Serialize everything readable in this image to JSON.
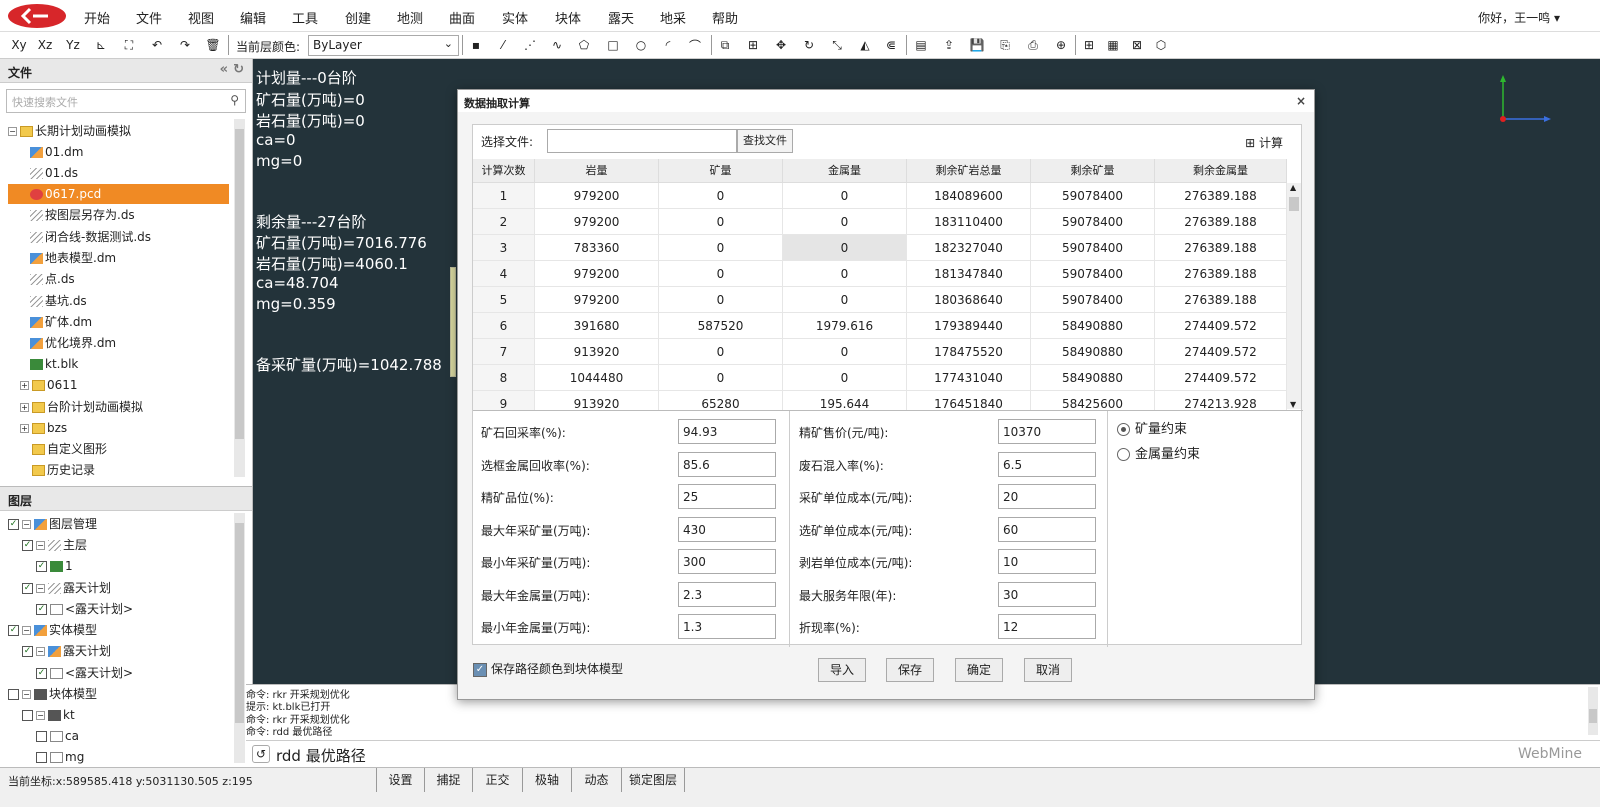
{
  "menu": [
    "开始",
    "文件",
    "视图",
    "编辑",
    "工具",
    "创建",
    "地测",
    "曲面",
    "实体",
    "块体",
    "露天",
    "地采",
    "帮助"
  ],
  "user": {
    "greeting": "你好，王一鸣 ▾"
  },
  "toolbar": {
    "coord_buttons": [
      "Xy",
      "Xz",
      "Yz"
    ],
    "layer_color_label": "当前层颜色:",
    "layer_color_value": "ByLayer"
  },
  "files_panel": {
    "title": "文件",
    "search_placeholder": "快速搜索文件",
    "items": [
      {
        "label": "长期计划动画模拟",
        "type": "folder"
      },
      {
        "label": "01.dm",
        "type": "dm"
      },
      {
        "label": "01.ds",
        "type": "ds"
      },
      {
        "label": "0617.pcd",
        "type": "pcd"
      },
      {
        "label": "按图层另存为.ds",
        "type": "ds"
      },
      {
        "label": "闭合线-数据测试.ds",
        "type": "ds"
      },
      {
        "label": "地表模型.dm",
        "type": "dm"
      },
      {
        "label": "点.ds",
        "type": "ds"
      },
      {
        "label": "基坑.ds",
        "type": "ds"
      },
      {
        "label": "矿体.dm",
        "type": "dm"
      },
      {
        "label": "优化境界.dm",
        "type": "dm"
      },
      {
        "label": "kt.blk",
        "type": "blk"
      },
      {
        "label": "0611",
        "type": "folder"
      },
      {
        "label": "台阶计划动画模拟",
        "type": "folder"
      },
      {
        "label": "bzs",
        "type": "folder"
      },
      {
        "label": "自定义图形",
        "type": "folder"
      },
      {
        "label": "历史记录",
        "type": "folder"
      }
    ]
  },
  "layers_panel": {
    "title": "图层",
    "items": [
      {
        "label": "图层管理"
      },
      {
        "label": "主层"
      },
      {
        "label": "1"
      },
      {
        "label": "露天计划"
      },
      {
        "label": "<露天计划>"
      },
      {
        "label": "实体模型"
      },
      {
        "label": "露天计划"
      },
      {
        "label": "<露天计划>"
      },
      {
        "label": "块体模型"
      },
      {
        "label": "kt"
      },
      {
        "label": "ca"
      },
      {
        "label": "mg"
      }
    ]
  },
  "canvas": {
    "plan": [
      "计划量---0台阶",
      "矿石量(万吨)=0",
      "岩石量(万吨)=0",
      "ca=0",
      "mg=0"
    ],
    "remain": [
      "剩余量---27台阶",
      "矿石量(万吨)=7016.776",
      "岩石量(万吨)=4060.1",
      "ca=48.704",
      "mg=0.359"
    ],
    "reserve": "备采矿量(万吨)=1042.788"
  },
  "command": {
    "history": [
      "命令:  rkr 开采规划优化",
      "提示:  kt.blk已打开",
      "命令:  rkr 开采规划优化",
      "命令:  rdd 最优路径"
    ],
    "current": "rdd 最优路径",
    "brand": "WebMine"
  },
  "statusbar": {
    "coords": "当前坐标:x:589585.418    y:5031130.505    z:195",
    "buttons": [
      "设置",
      "捕捉",
      "正交",
      "极轴",
      "动态",
      "锁定图层"
    ]
  },
  "dialog": {
    "title": "数据抽取计算",
    "close": "×",
    "file_label": "选择文件:",
    "find_button": "查找文件",
    "calc_button": "计算",
    "columns": [
      "计算次数",
      "岩量",
      "矿量",
      "金属量",
      "剩余矿岩总量",
      "剩余矿量",
      "剩余金属量"
    ],
    "rows": [
      [
        "1",
        "979200",
        "0",
        "0",
        "184089600",
        "59078400",
        "276389.188"
      ],
      [
        "2",
        "979200",
        "0",
        "0",
        "183110400",
        "59078400",
        "276389.188"
      ],
      [
        "3",
        "783360",
        "0",
        "0",
        "182327040",
        "59078400",
        "276389.188"
      ],
      [
        "4",
        "979200",
        "0",
        "0",
        "181347840",
        "59078400",
        "276389.188"
      ],
      [
        "5",
        "979200",
        "0",
        "0",
        "180368640",
        "59078400",
        "276389.188"
      ],
      [
        "6",
        "391680",
        "587520",
        "1979.616",
        "179389440",
        "58490880",
        "274409.572"
      ],
      [
        "7",
        "913920",
        "0",
        "0",
        "178475520",
        "58490880",
        "274409.572"
      ],
      [
        "8",
        "1044480",
        "0",
        "0",
        "177431040",
        "58490880",
        "274409.572"
      ],
      [
        "9",
        "913920",
        "65280",
        "195.644",
        "176451840",
        "58425600",
        "274213.928"
      ]
    ],
    "params_left": [
      {
        "label": "矿石回采率(%):",
        "value": "94.93"
      },
      {
        "label": "选框金属回收率(%):",
        "value": "85.6"
      },
      {
        "label": "精矿品位(%):",
        "value": "25"
      },
      {
        "label": "最大年采矿量(万吨):",
        "value": "430"
      },
      {
        "label": "最小年采矿量(万吨):",
        "value": "300"
      },
      {
        "label": "最大年金属量(万吨):",
        "value": "2.3"
      },
      {
        "label": "最小年金属量(万吨):",
        "value": "1.3"
      }
    ],
    "params_right": [
      {
        "label": "精矿售价(元/吨):",
        "value": "10370"
      },
      {
        "label": "废石混入率(%):",
        "value": "6.5"
      },
      {
        "label": "采矿单位成本(元/吨):",
        "value": "20"
      },
      {
        "label": "选矿单位成本(元/吨):",
        "value": "60"
      },
      {
        "label": "剥岩单位成本(元/吨):",
        "value": "10"
      },
      {
        "label": "最大服务年限(年):",
        "value": "30"
      },
      {
        "label": "折现率(%):",
        "value": "12"
      }
    ],
    "radios": [
      "矿量约束",
      "金属量约束"
    ],
    "save_color": "保存路径颜色到块体模型",
    "buttons": [
      "导入",
      "保存",
      "确定",
      "取消"
    ]
  }
}
